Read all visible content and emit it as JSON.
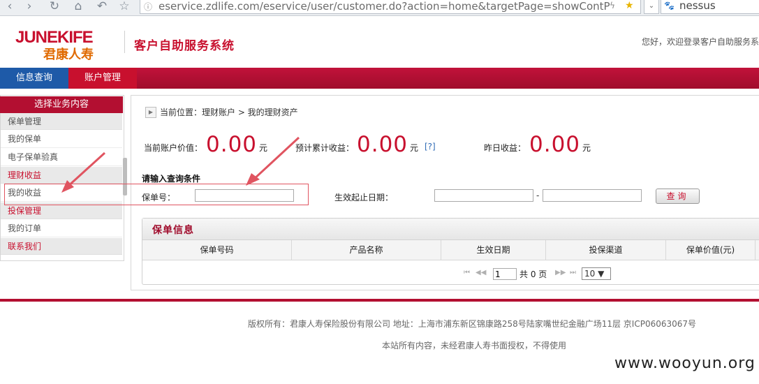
{
  "browser": {
    "url": "eservice.zdlife.com/eservice/user/customer.do?action=home&targetPage=showContP",
    "search_text": "nessus"
  },
  "header": {
    "logo_en": "JUNEKIFE",
    "logo_cn": "君康人寿",
    "system_title": "客户自助服务系统",
    "welcome": "您好，欢迎登录客户自助服务系"
  },
  "nav": {
    "tabs": [
      {
        "label": "信息查询"
      },
      {
        "label": "账户管理"
      }
    ]
  },
  "sidebar": {
    "heading": "选择业务内容",
    "items": [
      {
        "label": "保单管理"
      },
      {
        "label": "我的保单"
      },
      {
        "label": "电子保单验真"
      },
      {
        "label": "理财收益"
      },
      {
        "label": "我的收益"
      },
      {
        "label": "投保管理"
      },
      {
        "label": "我的订单"
      },
      {
        "label": "联系我们"
      }
    ]
  },
  "breadcrumb": "当前位置：理财账户 > 我的理财资产",
  "stats": {
    "current_value": {
      "label": "当前账户价值：",
      "value": "0.00",
      "unit": "元"
    },
    "expected_income": {
      "label": "预计累计收益：",
      "value": "0.00",
      "unit": "元",
      "help": "[?]"
    },
    "yesterday_income": {
      "label": "昨日收益：",
      "value": "0.00",
      "unit": "元"
    }
  },
  "query": {
    "title": "请输入查询条件",
    "policy_no_label": "保单号：",
    "policy_no_value": "",
    "date_label": "生效起止日期：",
    "date_from": "",
    "date_dash": "-",
    "date_to": "",
    "button": "查询"
  },
  "policy_table": {
    "title": "保单信息",
    "columns": [
      "保单号码",
      "产品名称",
      "生效日期",
      "投保渠道",
      "保单价值(元)"
    ]
  },
  "pager": {
    "first": "⏮",
    "prev": "◀◀",
    "page": "1",
    "total_text": "共 0 页",
    "next": "▶▶",
    "last": "⏭",
    "page_size": "10 ▼"
  },
  "footer": {
    "copyright": "版权所有：君康人寿保险股份有限公司  地址：上海市浦东新区锦康路258号陆家嘴世纪金融广场11层  京ICP06063067号",
    "notice": "本站所有内容，未经君康人寿书面授权，不得使用"
  },
  "watermark": "www.wooyun.org",
  "colors": {
    "brand_red": "#c8102e",
    "active_tab_blue": "#1e5aa8",
    "annotation_red": "#e05460"
  }
}
